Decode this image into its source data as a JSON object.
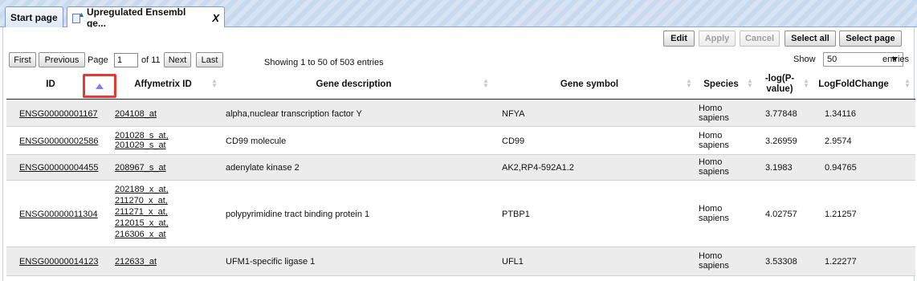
{
  "tabs": {
    "start_label": "Start page",
    "active_label": "Upregulated Ensembl ge...",
    "close_glyph": "X"
  },
  "toolbar": {
    "edit": "Edit",
    "apply": "Apply",
    "cancel": "Cancel",
    "select_all": "Select all",
    "select_page": "Select page"
  },
  "pager": {
    "first": "First",
    "previous": "Previous",
    "page_label": "Page",
    "page_value": "1",
    "of_label": "of 11",
    "next": "Next",
    "last": "Last",
    "showing": "Showing 1 to 50 of 503 entries",
    "show_label": "Show",
    "show_value": "50",
    "entries_label": "entries"
  },
  "table": {
    "columns": {
      "id": "ID",
      "affy": "Affymetrix ID",
      "desc": "Gene description",
      "symbol": "Gene symbol",
      "species": "Species",
      "logp": "-log(P-value)",
      "lfc": "LogFoldChange"
    },
    "rows": [
      {
        "id": "ENSG00000001167",
        "affy": [
          "204108_at"
        ],
        "desc": "alpha,nuclear transcription factor Y",
        "symbol": "NFYA",
        "species": "Homo sapiens",
        "logp": "3.77848",
        "lfc": "1.34116"
      },
      {
        "id": "ENSG00000002586",
        "affy": [
          "201028_s_at,",
          "201029_s_at"
        ],
        "desc": "CD99 molecule",
        "symbol": "CD99",
        "species": "Homo sapiens",
        "logp": "3.26959",
        "lfc": "2.9574"
      },
      {
        "id": "ENSG00000004455",
        "affy": [
          "208967_s_at"
        ],
        "desc": "adenylate kinase 2",
        "symbol": "AK2,RP4-592A1.2",
        "species": "Homo sapiens",
        "logp": "3.1983",
        "lfc": "0.94765"
      },
      {
        "id": "ENSG00000011304",
        "affy": [
          "202189_x_at,",
          "211270_x_at,",
          "211271_x_at,",
          "212015_x_at,",
          "216306_x_at"
        ],
        "desc": "polypyrimidine tract binding protein 1",
        "symbol": "PTBP1",
        "species": "Homo sapiens",
        "logp": "4.02757",
        "lfc": "1.21257"
      },
      {
        "id": "ENSG00000014123",
        "affy": [
          "212633_at"
        ],
        "desc": "UFM1-specific ligase 1",
        "symbol": "UFL1",
        "species": "Homo sapiens",
        "logp": "3.53308",
        "lfc": "1.22277"
      }
    ]
  }
}
